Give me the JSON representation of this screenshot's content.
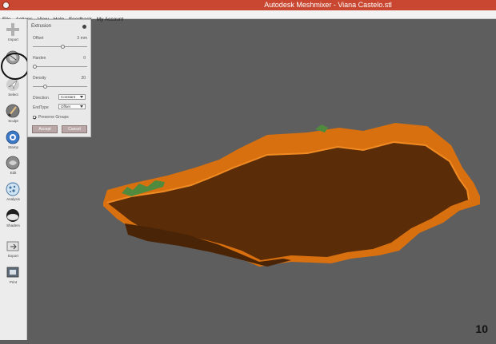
{
  "window": {
    "title": "Autodesk Meshmixer - Viana Castelo.stl"
  },
  "menu": [
    "File",
    "Actions",
    "View",
    "Help",
    "Feedback",
    "My Account"
  ],
  "tools": [
    {
      "label": "Import",
      "icon": "plus-icon"
    },
    {
      "label": "Meshmix",
      "icon": "meshmix-icon"
    },
    {
      "label": "Select",
      "icon": "select-arrow-icon"
    },
    {
      "label": "Sculpt",
      "icon": "brush-icon"
    },
    {
      "label": "Stamp",
      "icon": "stamp-icon"
    },
    {
      "label": "Edit",
      "icon": "edit-icon"
    },
    {
      "label": "Analysis",
      "icon": "analysis-icon"
    },
    {
      "label": "Shaders",
      "icon": "shader-icon"
    },
    {
      "label": "Export",
      "icon": "export-icon"
    },
    {
      "label": "Print",
      "icon": "print-icon"
    }
  ],
  "panel": {
    "title": "Extrusion",
    "offset": {
      "label": "Offset",
      "value": "3",
      "unit": "mm",
      "level": 0.55
    },
    "harden": {
      "label": "Harden",
      "value": "0",
      "level": 0.0
    },
    "density": {
      "label": "Density",
      "value": "20",
      "level": 0.2
    },
    "direction": {
      "label": "Direction",
      "value": "Constant"
    },
    "endtype": {
      "label": "EndType",
      "value": "Offset"
    },
    "preserve_groups": {
      "label": "Preserve Groups",
      "checked": true
    },
    "accept_label": "Accept",
    "cancel_label": "Cancel"
  },
  "step_number": "10",
  "colors": {
    "title_bar": "#c94630",
    "viewport_bg": "#5e5e5e",
    "mesh_side": "#d9700f",
    "mesh_top": "#5a2c08",
    "terrain": "#4f8a3f"
  }
}
